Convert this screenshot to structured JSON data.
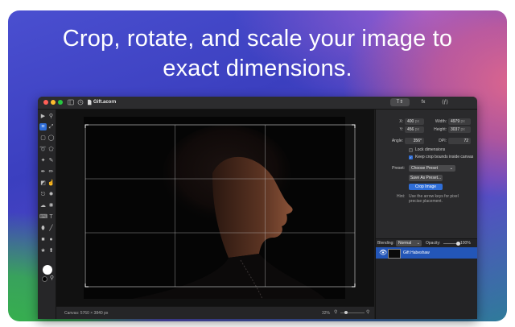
{
  "headline": {
    "line1": "Crop, rotate, and scale your image to",
    "line2": "exact dimensions."
  },
  "window": {
    "title": "Gift.acorn",
    "traffic_lights": [
      "#ff5f57",
      "#febc2e",
      "#28c840"
    ],
    "inspector_tabs": [
      {
        "label": "T⇕",
        "active": true
      },
      {
        "label": "fx",
        "active": false
      },
      {
        "label": "(ƒ)",
        "active": false
      }
    ]
  },
  "toolbar": {
    "tools": [
      "move-icon",
      "zoom-icon",
      "crop-icon",
      "expand-icon",
      "rect-select-icon",
      "ellipse-select-icon",
      "lasso-icon",
      "polygon-lasso-icon",
      "magic-wand-icon",
      "brush-icon",
      "pen-icon",
      "pencil-icon",
      "eraser-icon",
      "smudge-icon",
      "clone-icon",
      "gradient-icon",
      "text-icon",
      "bezier-icon",
      "shape-rect-icon",
      "shape-ellipse-icon",
      "star-icon",
      "arrow-icon"
    ],
    "foreground_color": "#ffffff",
    "background_color": "#000000"
  },
  "crop_panel": {
    "x_label": "X:",
    "x_value": "400",
    "x_unit": "px",
    "width_label": "Width:",
    "width_value": "4979",
    "width_unit": "px",
    "y_label": "Y:",
    "y_value": "456",
    "y_unit": "px",
    "height_label": "Height:",
    "height_value": "3037",
    "height_unit": "px",
    "angle_label": "Angle:",
    "angle_value": "356°",
    "dpi_label": "DPI:",
    "dpi_value": "72",
    "lock_dimensions": {
      "label": "Lock dimensions",
      "checked": false
    },
    "keep_bounds": {
      "label": "Keep crop bounds inside canvas",
      "checked": true
    },
    "preset_label": "Preset:",
    "preset_value": "Choose Preset",
    "save_preset_label": "Save As Preset...",
    "crop_button_label": "Crop Image",
    "hint_label": "Hint:",
    "hint_text_line1": "Use the arrow keys for pixel",
    "hint_text_line2": "precise placement."
  },
  "layers_panel": {
    "blending_label": "Blending:",
    "blending_value": "Normal",
    "opacity_label": "Opacity:",
    "opacity_fraction": 1.0,
    "opacity_value": "100%",
    "layers": [
      {
        "name": "Gift Habeshaw",
        "visible": true,
        "selected": true
      }
    ]
  },
  "statusbar": {
    "canvas_info": "Canvas: 5760 × 3840 px",
    "zoom": "32%"
  },
  "accent_color": "#2f6ed8"
}
